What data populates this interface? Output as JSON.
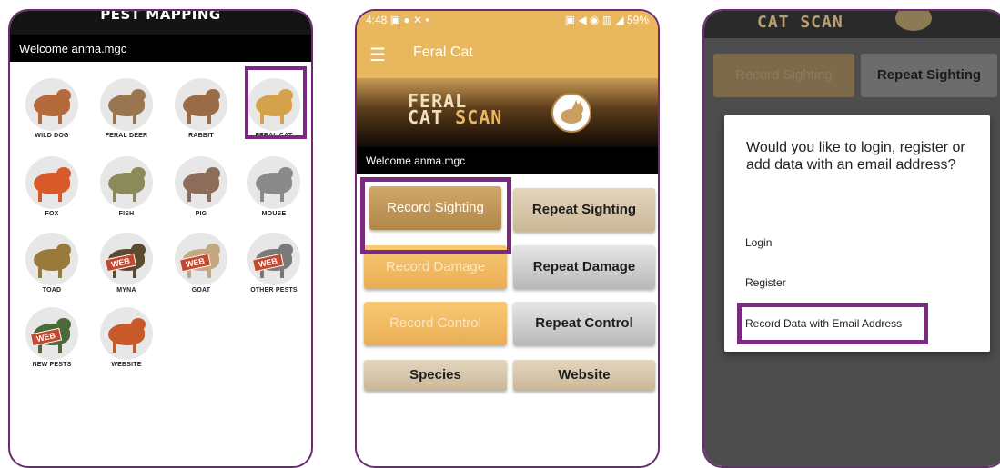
{
  "phone1": {
    "title": "PEST MAPPING",
    "welcome": "Welcome anma.mgc",
    "pests": [
      {
        "label": "WILD DOG",
        "icon": "wild-dog-icon",
        "color": "#b46a3a",
        "web": false
      },
      {
        "label": "FERAL DEER",
        "icon": "feral-deer-icon",
        "color": "#9a7650",
        "web": false
      },
      {
        "label": "RABBIT",
        "icon": "rabbit-icon",
        "color": "#9b6b45",
        "web": false
      },
      {
        "label": "FERAL CAT",
        "icon": "feral-cat-icon",
        "color": "#d4a24a",
        "web": false
      },
      {
        "label": "FOX",
        "icon": "fox-icon",
        "color": "#d85a2a",
        "web": false
      },
      {
        "label": "FISH",
        "icon": "fish-icon",
        "color": "#8a8a5a",
        "web": false
      },
      {
        "label": "PIG",
        "icon": "pig-icon",
        "color": "#8d6d5a",
        "web": false
      },
      {
        "label": "MOUSE",
        "icon": "mouse-icon",
        "color": "#8a8a8a",
        "web": false
      },
      {
        "label": "TOAD",
        "icon": "toad-icon",
        "color": "#9a7a3a",
        "web": false
      },
      {
        "label": "MYNA",
        "icon": "myna-icon",
        "color": "#5a4a30",
        "web": true
      },
      {
        "label": "GOAT",
        "icon": "goat-icon",
        "color": "#c4a980",
        "web": true
      },
      {
        "label": "OTHER PESTS",
        "icon": "donkey-icon",
        "color": "#7a7a7a",
        "web": true
      },
      {
        "label": "NEW PESTS",
        "icon": "turtle-icon",
        "color": "#4a6a3a",
        "web": true
      },
      {
        "label": "WEBSITE",
        "icon": "australia-map-icon",
        "color": "#c85a2a",
        "web": false
      }
    ],
    "web_tag": "WEB"
  },
  "phone2": {
    "status_time": "4:48",
    "status_battery": "59%",
    "app_title": "Feral Cat",
    "logo_line1": "FERAL",
    "logo_line2a": "CAT",
    "logo_line2b": "SCAN",
    "welcome": "Welcome anma.mgc",
    "buttons": {
      "record_sighting": "Record Sighting",
      "repeat_sighting": "Repeat Sighting",
      "record_damage": "Record Damage",
      "repeat_damage": "Repeat Damage",
      "record_control": "Record Control",
      "repeat_control": "Repeat Control",
      "species": "Species",
      "website": "Website"
    }
  },
  "phone3": {
    "logo": "CAT SCAN",
    "bg_buttons": {
      "record_sighting": "Record Sighting",
      "repeat_sighting": "Repeat Sighting"
    },
    "dialog": {
      "question": "Would you like to login, register or add data with an email address?",
      "login": "Login",
      "register": "Register",
      "record_email": "Record Data with Email Address"
    }
  },
  "colors": {
    "accent_purple": "#7a2a80",
    "gold": "#e9b85e"
  }
}
